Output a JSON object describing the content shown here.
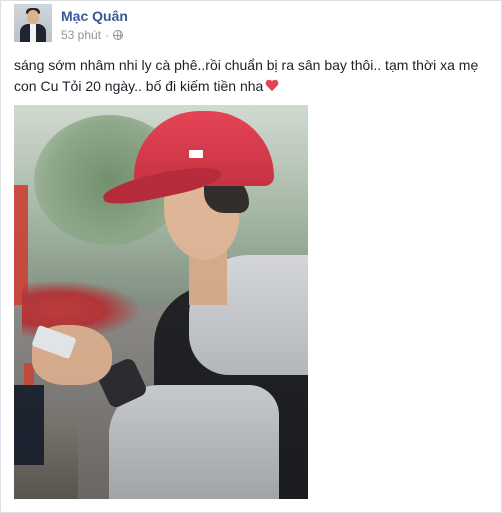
{
  "post": {
    "author": "Mạc Quân",
    "time": "53 phút",
    "separator": "·",
    "privacy_icon": "globe-icon",
    "text": "sáng sớm nhâm nhi ly cà phê..rồi chuẩn bị ra sân bay thôi.. tạm thời xa mẹ con Cu Tỏi 20 ngày.. bố đi kiếm tiền nha",
    "emoji_icon": "heart-icon"
  },
  "colors": {
    "author_link": "#365899",
    "meta": "#90949c",
    "heart": "#e0455a"
  }
}
